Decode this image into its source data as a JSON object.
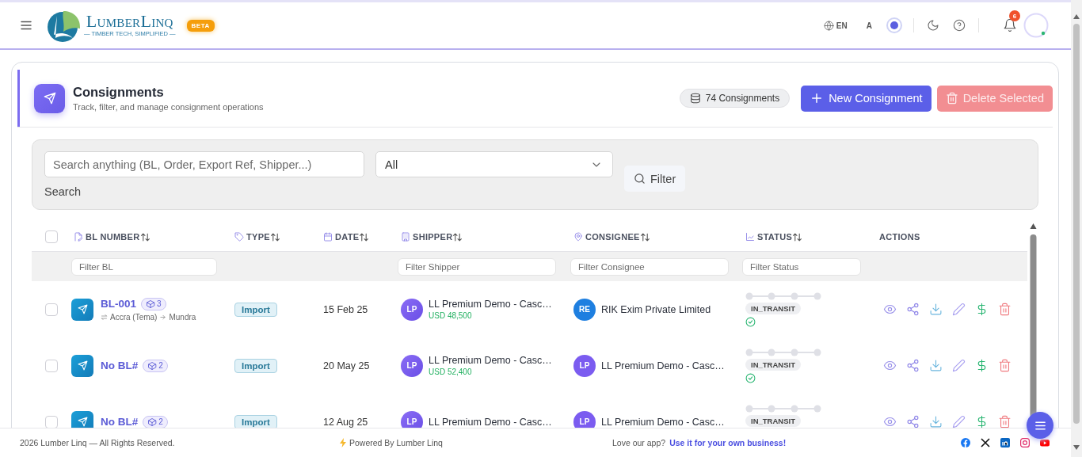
{
  "header": {
    "logo_name": "LumberLinq",
    "logo_tagline": "— TIMBER TECH, SIMPLIFIED —",
    "badge": "BETA",
    "language": "EN",
    "font_size_label": "A",
    "notification_count": "6"
  },
  "page": {
    "title": "Consignments",
    "subtitle": "Track, filter, and manage consignment operations",
    "count": "74 Consignments",
    "buttons": [
      {
        "label": "New Consignment",
        "kind": "primary",
        "disabled": false
      },
      {
        "label": "Delete Selected",
        "kind": "danger",
        "disabled": true
      }
    ]
  },
  "filters": {
    "search": {
      "placeholder": "Search anything (BL, Order, Export Ref, Shipper...)",
      "label": "Search"
    },
    "type_select": {
      "value": "All"
    },
    "filter_button": "Filter"
  },
  "table": {
    "select_all": {
      "checked": false
    },
    "columns": [
      {
        "label": "BL NUMBER",
        "sortable": true,
        "filter_placeholder": "Filter BL"
      },
      {
        "label": "TYPE",
        "sortable": true
      },
      {
        "label": "DATE",
        "sortable": true
      },
      {
        "label": "SHIPPER",
        "sortable": true,
        "filter_placeholder": "Filter Shipper"
      },
      {
        "label": "CONSIGNEE",
        "sortable": true,
        "filter_placeholder": "Filter Consignee"
      },
      {
        "label": "STATUS",
        "sortable": true,
        "filter_placeholder": "Filter Status"
      },
      {
        "label": "ACTIONS",
        "sortable": false
      }
    ],
    "rows": [
      {
        "checked": false,
        "bl": "BL-001",
        "packages": "3",
        "route_from": "Accra (Tema)",
        "route_to": "Mundra",
        "type": "Import",
        "date": "15 Feb 25",
        "shipper_initials": "LP",
        "shipper": "LL Premium Demo - Casc…",
        "amount": "USD 48,500",
        "consignee_initials": "RE",
        "color": "#1e7fe0",
        "consignee": "RIK Exim Private Limited",
        "status": "IN_TRANSIT",
        "verified": true
      },
      {
        "checked": false,
        "bl": "No BL#",
        "packages": "2",
        "type": "Import",
        "date": "20 May 25",
        "shipper_initials": "LP",
        "shipper": "LL Premium Demo - Casc…",
        "amount": "USD 52,400",
        "consignee_initials": "LP",
        "color": "#7b5cf0",
        "consignee": "LL Premium Demo - Casc…",
        "status": "IN_TRANSIT",
        "verified": true
      },
      {
        "checked": false,
        "bl": "No BL#",
        "packages": "2",
        "type": "Import",
        "date": "12 Aug 25",
        "shipper_initials": "LP",
        "shipper": "LL Premium Demo - Casc…",
        "consignee_initials": "LP",
        "color": "#7b5cf0",
        "consignee": "LL Premium Demo - Casc…",
        "status": "IN_TRANSIT"
      }
    ]
  },
  "footer": {
    "copyright": "2026 Lumber Linq — All Rights Reserved.",
    "powered": "Powered By Lumber Linq",
    "promo": "Love our app?",
    "promo_link": "Use it for your own business!"
  }
}
